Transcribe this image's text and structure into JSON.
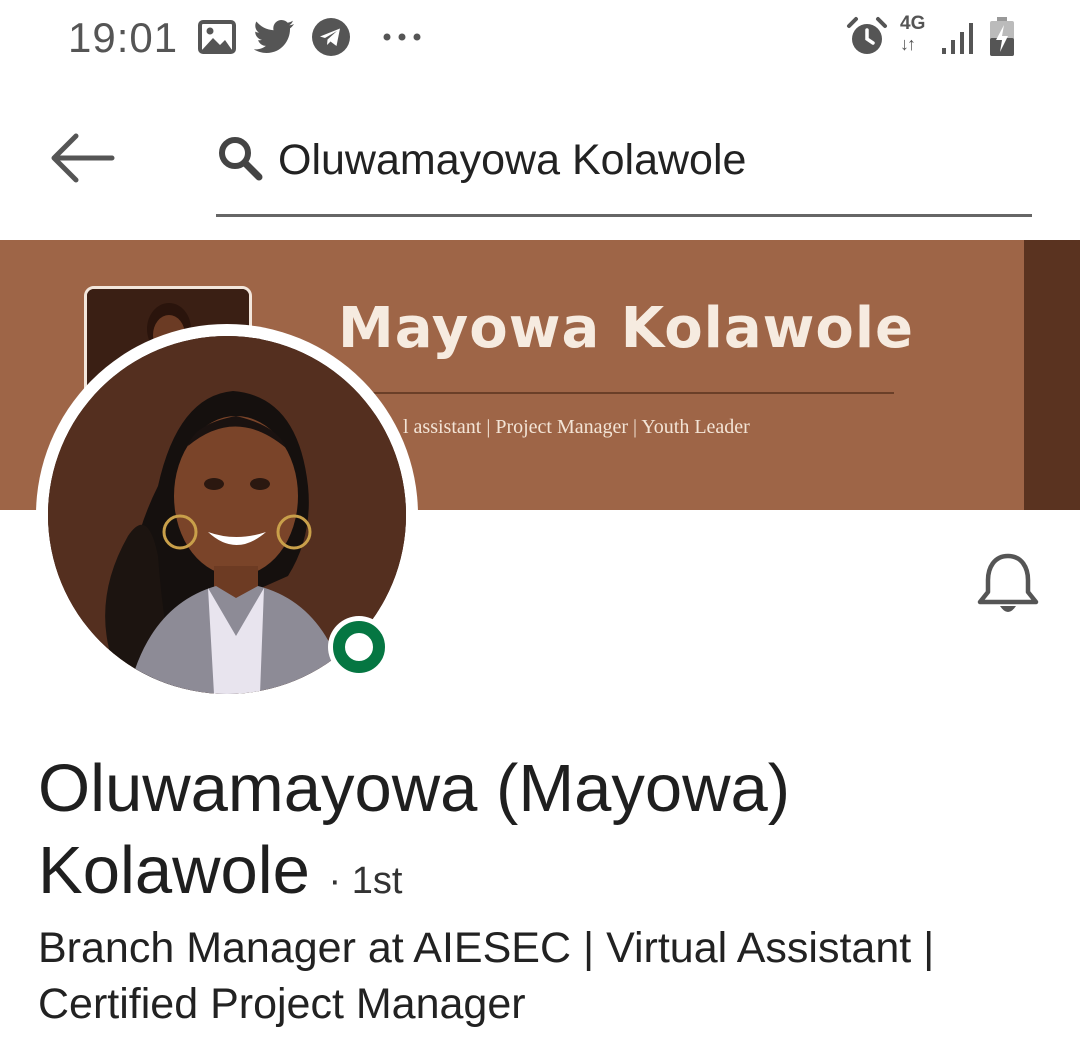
{
  "status_bar": {
    "time": "19:01",
    "network": "4G",
    "notification_icons": [
      "gallery-icon",
      "twitter-icon",
      "telegram-icon",
      "more-icon"
    ],
    "system_icons": [
      "alarm-icon",
      "network-4g-icon",
      "signal-icon",
      "battery-charging-icon"
    ]
  },
  "header": {
    "search_query": "Oluwamayowa Kolawole"
  },
  "banner": {
    "title": "Mayowa Kolawole",
    "subtitle": "l assistant | Project Manager | Youth Leader",
    "background_color": "#9e6547"
  },
  "profile": {
    "name": "Oluwamayowa (Mayowa) Kolawole",
    "degree": "· 1st",
    "headline": "Branch Manager at AIESEC | Virtual Assistant | Certified Project Manager",
    "online_status_color": "#057642"
  }
}
